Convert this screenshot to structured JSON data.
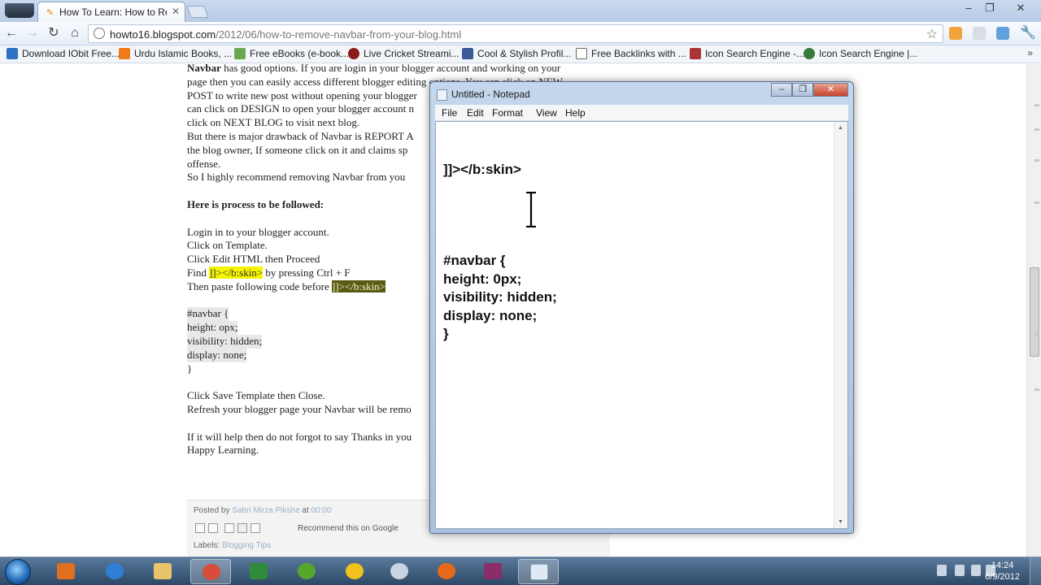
{
  "browser": {
    "tab_title": "How To Learn: How to Rem",
    "tab_close": "✕",
    "url_host": "howto16.blogspot.com",
    "url_path": "/2012/06/how-to-remove-navbar-from-your-blog.html",
    "window_controls": [
      "‒",
      "❐",
      "✕"
    ],
    "bookmarks": [
      {
        "label": "Download IObit Free...",
        "color": "#2f6fc2"
      },
      {
        "label": "Urdu Islamic Books, ...",
        "color": "#f07a1a"
      },
      {
        "label": "Free eBooks (e-book...",
        "color": "#6aa84f"
      },
      {
        "label": "Live Cricket Streami...",
        "color": "#8b1a1a"
      },
      {
        "label": "Cool & Stylish Profil...",
        "color": "#3b5998"
      },
      {
        "label": "Free Backlinks with ...",
        "color": "#666666"
      },
      {
        "label": "Icon Search Engine -...",
        "color": "#a33"
      },
      {
        "label": "Icon Search Engine |...",
        "color": "#3a7a3a"
      }
    ],
    "bookmarks_more": "»"
  },
  "article": {
    "lines": [
      {
        "bold_prefix": "Navbar",
        "text": " has good options. If you are login in your blogger account and working on your"
      },
      {
        "text": "page then you can easily access different blogger editing options. You can click on NEW"
      },
      {
        "text": "POST to write new post without opening your blogger"
      },
      {
        "text": "can click on DESIGN to open your blogger account n"
      },
      {
        "text": "click on NEXT BLOG to visit next blog."
      },
      {
        "text": "But there is major drawback of Navbar is REPORT A"
      },
      {
        "text": "the blog owner, If someone click on it and claims sp"
      },
      {
        "text": "offense."
      },
      {
        "text": "So I highly recommend removing Navbar from you"
      }
    ],
    "heading": "Here is process to be followed:",
    "steps": [
      "Login in to your blogger account.",
      "Click on Template.",
      "Click Edit HTML then Proceed"
    ],
    "find_prefix": "Find ",
    "find_code": "]]></b:skin>",
    "find_suffix": " by pressing Ctrl + F",
    "paste_prefix": "Then paste following code before ",
    "paste_code": "]]></b:skin>",
    "code": [
      "#navbar {",
      "height: opx;",
      "visibility: hidden;",
      "display: none;",
      "}"
    ],
    "after": [
      "Click Save Template then Close.",
      "Refresh your blogger page your Navbar will be remo"
    ],
    "closing": [
      "If it will help then do not forgot to say Thanks in you",
      "Happy Learning."
    ]
  },
  "post_footer": {
    "posted_by": "Posted by",
    "author": "Sabri Mirza Pikshe",
    "at": "at",
    "time": "00:00",
    "recommend": "Recommend this on Google",
    "labels": "Labels:",
    "label_value": "Blogging Tips"
  },
  "notepad": {
    "title": "Untitled - Notepad",
    "menus": [
      "File",
      "Edit",
      "Format",
      "View",
      "Help"
    ],
    "lines": [
      "]]></b:skin>",
      "#navbar {",
      "height: 0px;",
      "visibility: hidden;",
      "display: none;",
      "}"
    ],
    "close_glyph": "✕",
    "min_glyph": "‒",
    "max_glyph": "❐"
  },
  "taskbar": {
    "time": "14:24",
    "date": "6/9/2012"
  }
}
